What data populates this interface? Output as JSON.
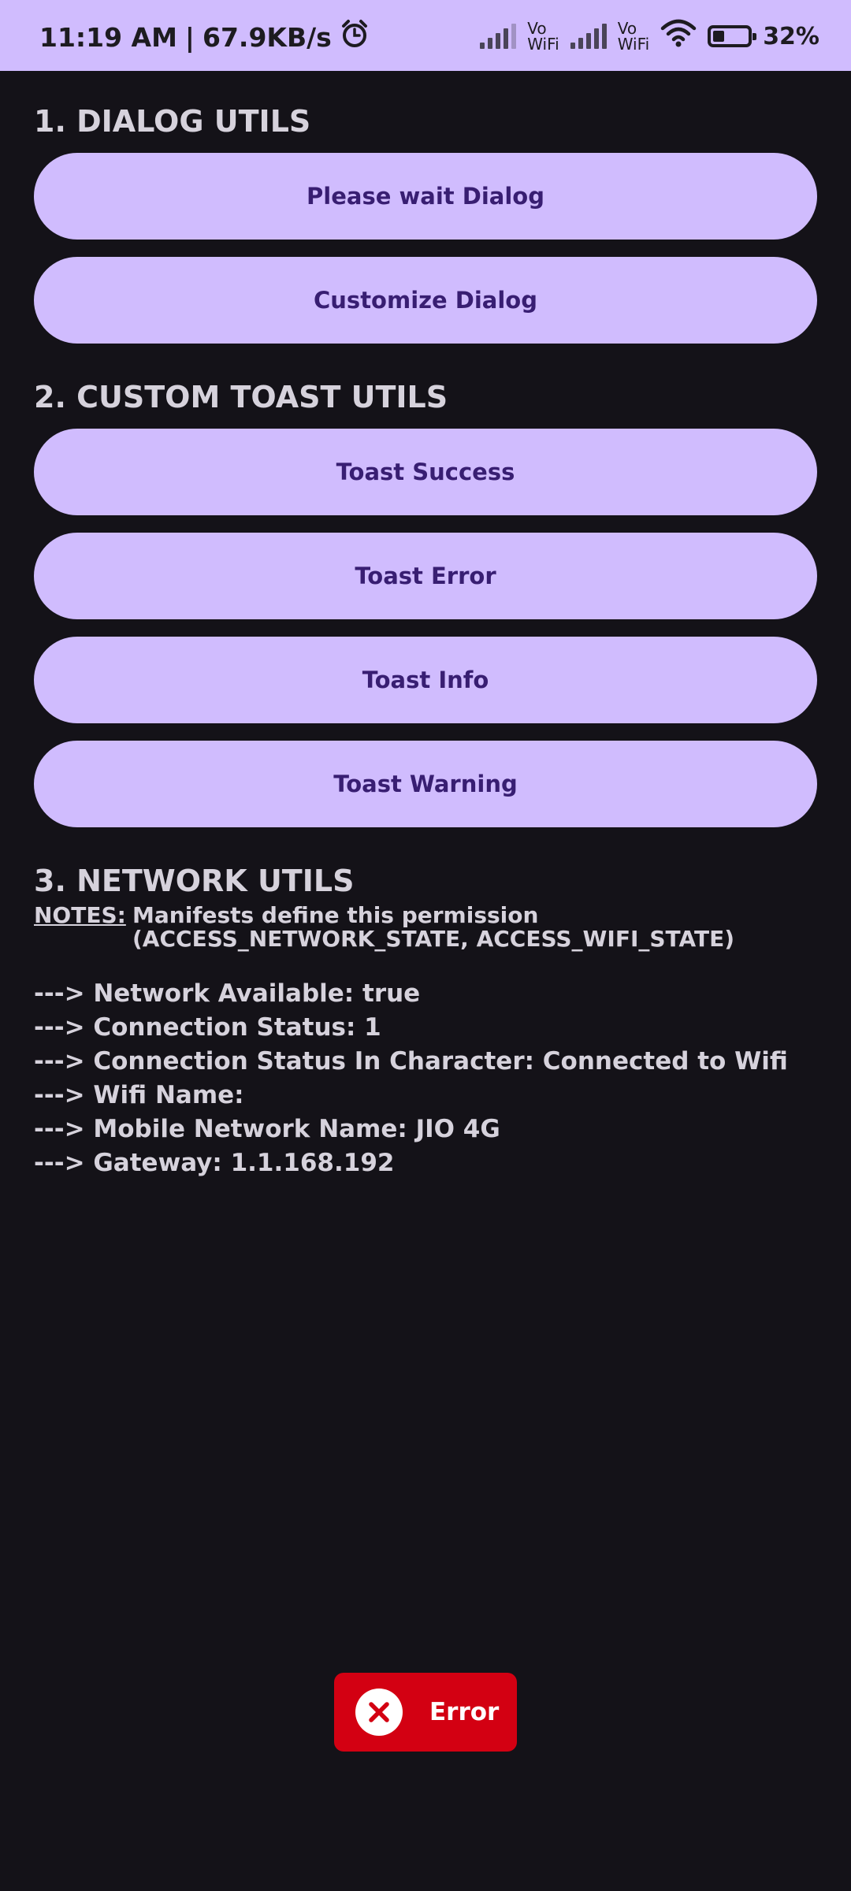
{
  "status_bar": {
    "time": "11:19 AM",
    "separator": "|",
    "speed": "67.9KB/s",
    "vo_label": "Vo",
    "wifi_label": "WiFi",
    "battery": "32%",
    "battery_level": 0.32,
    "alarm_icon": "alarm-clock-icon"
  },
  "sections": {
    "dialog": {
      "title": "1. DIALOG UTILS",
      "buttons": [
        "Please wait Dialog",
        "Customize Dialog"
      ]
    },
    "toast": {
      "title": "2. CUSTOM TOAST UTILS",
      "buttons": [
        "Toast Success",
        "Toast Error",
        "Toast Info",
        "Toast Warning"
      ]
    },
    "network": {
      "title": "3. NETWORK UTILS",
      "notes_label": "NOTES:",
      "notes_text": "Manifests define this permission (ACCESS_NETWORK_STATE, ACCESS_WIFI_STATE)",
      "lines": [
        "---> Network Available: true",
        "---> Connection Status: 1",
        "---> Connection Status In Character: Connected to Wifi",
        "---> Wifi Name:",
        "---> Mobile Network Name: JIO 4G",
        "---> Gateway: 1.1.168.192"
      ]
    }
  },
  "toast_message": {
    "text": "Error",
    "icon": "close-circle-icon",
    "color": "#d30012"
  },
  "colors": {
    "accent": "#d0bcfe",
    "on_accent": "#381e72",
    "background": "#141218",
    "text": "#d6d2dc"
  }
}
